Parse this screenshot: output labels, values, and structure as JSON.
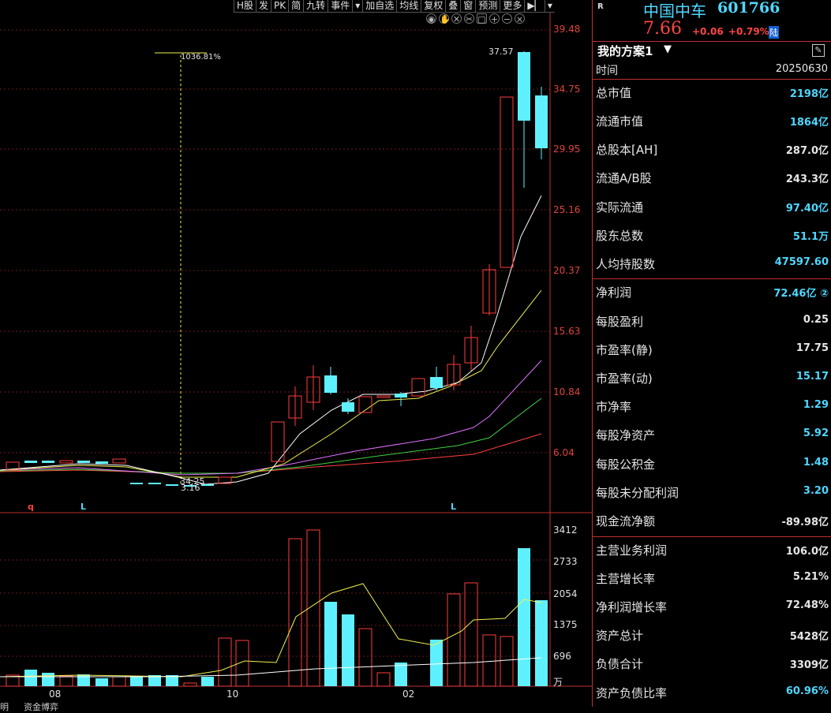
{
  "toolbar": [
    "H股",
    "发",
    "PK",
    "简",
    "九转",
    "事件",
    "▾",
    "加自选",
    "均线",
    "复权",
    "叠",
    "窗",
    "预测",
    "更多",
    "▶▏",
    "▾"
  ],
  "icons": [
    "eye-icon",
    "hand-icon",
    "cross-icon",
    "scissors-icon",
    "lock-icon",
    "zoom-in-icon",
    "zoom-out-icon",
    "close-icon"
  ],
  "chart": {
    "price_axis": [
      "39.48",
      "34.75",
      "29.95",
      "25.16",
      "20.37",
      "15.63",
      "10.84",
      "6.04"
    ],
    "volume_axis": [
      "3412",
      "2733",
      "2054",
      "1375",
      "696",
      "万"
    ],
    "months": [
      "08",
      "10",
      "02"
    ],
    "markers": {
      "q": "q",
      "l1": "L",
      "l2": "L"
    },
    "annotations": {
      "max_pct": "1036.81%",
      "high": "37.57",
      "low": "3.16",
      "low_mid": "34.25"
    },
    "colors": {
      "up": "#ff3b3b",
      "down": "#5ff0ff",
      "ma5": "#ffffff",
      "ma10": "#f0f050",
      "ma20": "#e070ff",
      "ma30": "#40d040",
      "ma60": "#ff4040"
    }
  },
  "panel": {
    "flag": "R",
    "stock_name": "中国中车",
    "stock_code": "601766",
    "price": "7.66",
    "change": "+0.06",
    "change_pct": "+0.79%",
    "market_tag": "陆",
    "scheme_title": "我的方案1",
    "time_label": "时间",
    "time_value": "20250630",
    "rows": [
      {
        "label": "总市值",
        "value": "2198亿",
        "color": "cyan"
      },
      {
        "label": "流通市值",
        "value": "1864亿",
        "color": "cyan"
      },
      {
        "label": "总股本[AH]",
        "value": "287.0亿",
        "color": "white"
      },
      {
        "label": "流通A/B股",
        "value": "243.3亿",
        "color": "white"
      },
      {
        "label": "实际流通",
        "value": "97.40亿",
        "color": "cyan"
      },
      {
        "label": "股东总数",
        "value": "51.1万",
        "color": "cyan"
      },
      {
        "label": "人均持股数",
        "value": "47597.60",
        "color": "cyan"
      },
      {
        "label": "净利润",
        "value": "72.46亿 ②",
        "color": "cyan"
      },
      {
        "label": "每股盈利",
        "value": "0.25",
        "color": "white"
      },
      {
        "label": "市盈率(静)",
        "value": "17.75",
        "color": "white"
      },
      {
        "label": "市盈率(动)",
        "value": "15.17",
        "color": "cyan"
      },
      {
        "label": "市净率",
        "value": "1.29",
        "color": "cyan"
      },
      {
        "label": "每股净资产",
        "value": "5.92",
        "color": "cyan"
      },
      {
        "label": "每股公积金",
        "value": "1.48",
        "color": "cyan"
      },
      {
        "label": "每股未分配利润",
        "value": "3.20",
        "color": "cyan"
      },
      {
        "label": "现金流净额",
        "value": "-89.98亿",
        "color": "white"
      },
      {
        "label": "主营业务利润",
        "value": "106.0亿",
        "color": "white"
      },
      {
        "label": "主营增长率",
        "value": "5.21%",
        "color": "white"
      },
      {
        "label": "净利润增长率",
        "value": "72.48%",
        "color": "white"
      },
      {
        "label": "资产总计",
        "value": "5428亿",
        "color": "white"
      },
      {
        "label": "负债合计",
        "value": "3309亿",
        "color": "white"
      },
      {
        "label": "资产负债比率",
        "value": "60.96%",
        "color": "cyan"
      }
    ]
  },
  "bottom_tabs": [
    "明",
    "资金博弈"
  ]
}
